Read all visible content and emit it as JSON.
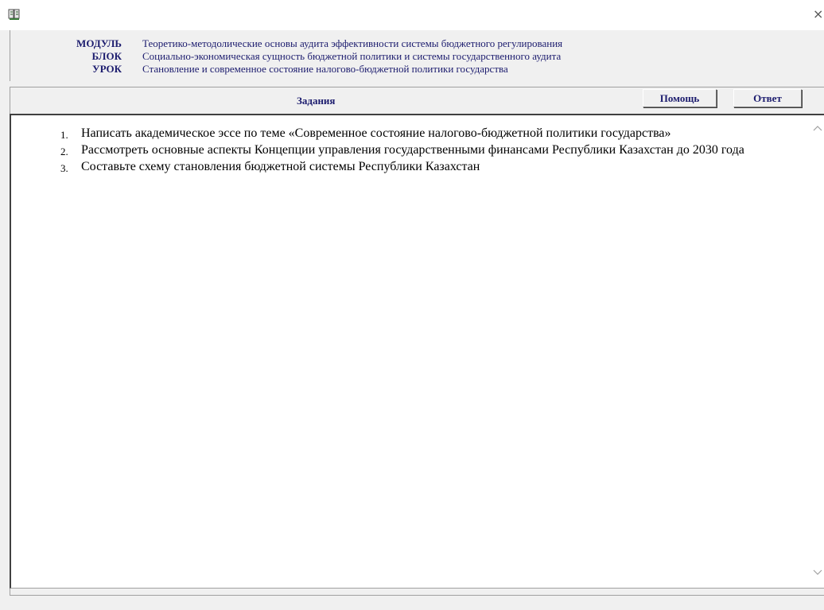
{
  "window": {
    "close_glyph": "×"
  },
  "info": {
    "rows": [
      {
        "label": "МОДУЛЬ",
        "value": "Теоретико-методолические основы аудита эффективности системы бюджетного регулирования"
      },
      {
        "label": "БЛОК",
        "value": "Социально-экономическая сущность бюджетной политики и системы государственного аудита"
      },
      {
        "label": "УРОК",
        "value": "Становление и современное состояние налогово-бюджетной политики государства"
      }
    ]
  },
  "tabbar": {
    "title": "Задания",
    "help_label": "Помощь",
    "answer_label": "Ответ"
  },
  "tasks": [
    {
      "num": "1.",
      "text": "Написать академическое эссе по теме «Современное состояние налогово-бюджетной политики государства»"
    },
    {
      "num": "2.",
      "text": "Рассмотреть основные аспекты Концепции управления государственными финансами Республики Казахстан до 2030 года"
    },
    {
      "num": "3.",
      "text": "Составьте схему становления бюджетной системы Республики Казахстан"
    }
  ],
  "icons": {
    "app": "book-icon",
    "close": "close-icon",
    "scroll_up": "chevron-up-icon",
    "scroll_down": "chevron-down-icon"
  },
  "colors": {
    "label_text": "#1c1c6e",
    "window_bg": "#f0f0f0",
    "content_bg": "#ffffff"
  }
}
